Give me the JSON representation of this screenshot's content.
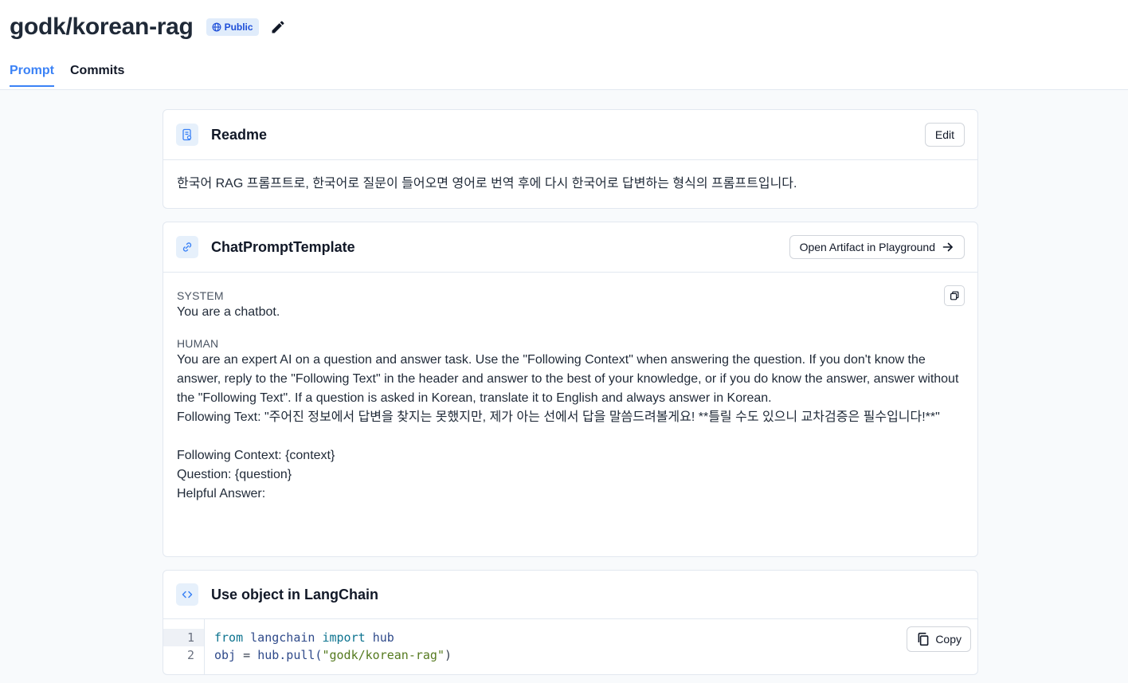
{
  "header": {
    "repo_title": "godk/korean-rag",
    "visibility_badge": "Public",
    "tabs": [
      {
        "label": "Prompt",
        "active": true
      },
      {
        "label": "Commits",
        "active": false
      }
    ]
  },
  "readme": {
    "title": "Readme",
    "edit_label": "Edit",
    "body": "한국어 RAG 프롬프트로, 한국어로 질문이 들어오면 영어로 번역 후에 다시 한국어로 답변하는 형식의 프롬프트입니다."
  },
  "template": {
    "title": "ChatPromptTemplate",
    "open_label": "Open Artifact in Playground",
    "messages": [
      {
        "role": "SYSTEM",
        "text": "You are a chatbot."
      },
      {
        "role": "HUMAN",
        "text": "You are an expert AI on a question and answer task. Use the \"Following Context\" when answering the question. If you don't know the answer, reply to the \"Following Text\" in the header and answer to the best of your knowledge, or if you do know the answer, answer without the \"Following Text\". If a question is asked in Korean, translate it to English and always answer in Korean.\nFollowing Text: \"주어진 정보에서 답변을 찾지는 못했지만, 제가 아는 선에서 답을 말씀드려볼게요! **틀릴 수도 있으니 교차검증은 필수입니다!**\"\n\nFollowing Context: {context}\nQuestion: {question}\nHelpful Answer:"
      }
    ]
  },
  "usage": {
    "title": "Use object in LangChain",
    "copy_label": "Copy",
    "line_numbers": [
      "1",
      "2"
    ],
    "line1": {
      "kw1": "from",
      "mod": "langchain",
      "kw2": "import",
      "name": "hub"
    },
    "line2": {
      "var": "obj",
      "eq": "=",
      "call": "hub.pull(",
      "arg": "\"godk/korean-rag\"",
      "close": ")"
    }
  },
  "colors": {
    "accent": "#3b82f6",
    "badge_bg": "#e0ecfb",
    "card_border": "#e2e8f0"
  },
  "icons": [
    "globe-icon",
    "pencil-icon",
    "document-icon",
    "link-icon",
    "copy-icon",
    "arrow-right-icon",
    "code-icon"
  ]
}
